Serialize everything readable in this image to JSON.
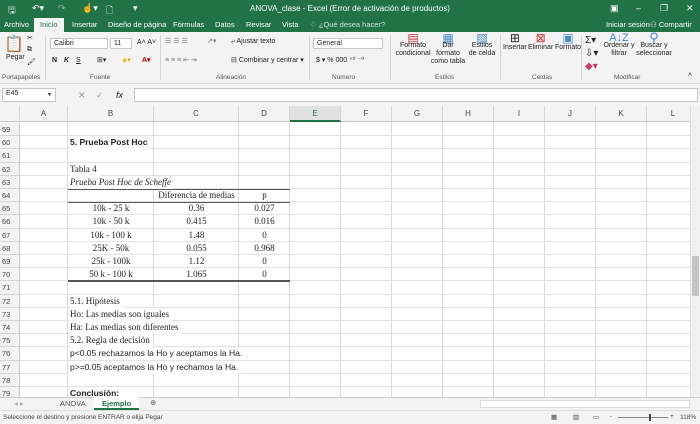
{
  "title": "ANOVA_clase - Excel (Error de activación de productos)",
  "tabs": [
    "Archivo",
    "Inicio",
    "Insertar",
    "Diseño de página",
    "Fórmulas",
    "Datos",
    "Revisar",
    "Vista"
  ],
  "tell_me": "¿Qué desea hacer?",
  "signin": "Iniciar sesión",
  "share": "Compartir",
  "ribbon": {
    "paste": "Pegar",
    "clipboard": "Portapapeles",
    "font_name": "Calibri",
    "font_size": "11",
    "font": "Fuente",
    "bold": "N",
    "italic": "K",
    "underline": "S",
    "wrap": "Ajustar texto",
    "merge": "Combinar y centrar",
    "alignment": "Alineación",
    "number_format": "General",
    "number": "Número",
    "cond_format": "Formato condicional",
    "format_table": "Dar formato como tabla",
    "cell_styles": "Estilos de celda",
    "styles": "Estilos",
    "insert": "Insertar",
    "delete": "Eliminar",
    "format": "Formato",
    "cells": "Celdas",
    "sort": "Ordenar y filtrar",
    "find": "Buscar y seleccionar",
    "editing": "Modificar"
  },
  "name_box": "E45",
  "formula": "",
  "columns": [
    "A",
    "B",
    "C",
    "D",
    "E",
    "F",
    "G",
    "H",
    "I",
    "J",
    "K",
    "L"
  ],
  "selected_column": "E",
  "rows": [
    59,
    60,
    61,
    62,
    63,
    64,
    65,
    66,
    67,
    68,
    69,
    70,
    71,
    72,
    73,
    74,
    75,
    76,
    77,
    78,
    79
  ],
  "cells": {
    "60": {
      "B": "5. Prueba Post Hoc"
    },
    "62": {
      "B": "Tabla 4"
    },
    "63": {
      "B": "Prueba Post Hoc de Scheffe"
    },
    "64": {
      "C": "Diferencia de medias",
      "D": "p"
    },
    "65": {
      "B": "10k - 25 k",
      "C": "0.36",
      "D": "0.027"
    },
    "66": {
      "B": "10k - 50 k",
      "C": "0.415",
      "D": "0.016"
    },
    "67": {
      "B": "10k - 100 k",
      "C": "1.48",
      "D": "0"
    },
    "68": {
      "B": "25K - 50k",
      "C": "0.055",
      "D": "0.968"
    },
    "69": {
      "B": "25k - 100k",
      "C": "1.12",
      "D": "0"
    },
    "70": {
      "B": "50 k - 100 k",
      "C": "1.065",
      "D": "0"
    },
    "72": {
      "B": "5.1. Hipótesis"
    },
    "73": {
      "B": "Ho: Las medias son iguales"
    },
    "74": {
      "B": "Ha: Las medias son diferentes"
    },
    "75": {
      "B": "5.2. Regla de decisión"
    },
    "76": {
      "B": "p<0.05 rechazamos la Ho y aceptamos la Ha."
    },
    "77": {
      "B": "p>=0.05 aceptamos la Ho y rechamos la Ha."
    },
    "79": {
      "B": "Conclusión:"
    }
  },
  "sheets": [
    "ANOVA",
    "Ejemplo"
  ],
  "active_sheet": "Ejemplo",
  "status": "Seleccione el destino y presione ENTRAR o elija Pegar",
  "zoom": "118%"
}
